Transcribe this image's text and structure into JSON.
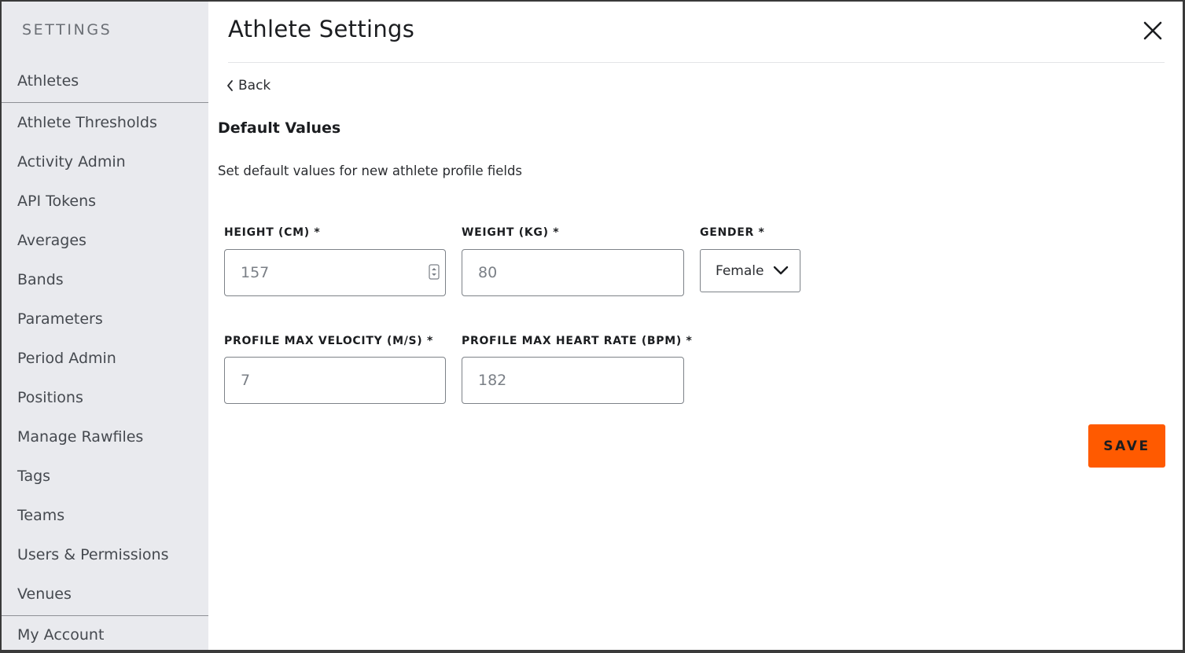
{
  "sidebar": {
    "heading": "SETTINGS",
    "items": [
      {
        "label": "Athletes"
      },
      {
        "label": "Athlete Thresholds"
      },
      {
        "label": "Activity Admin"
      },
      {
        "label": "API Tokens"
      },
      {
        "label": "Averages"
      },
      {
        "label": "Bands"
      },
      {
        "label": "Parameters"
      },
      {
        "label": "Period Admin"
      },
      {
        "label": "Positions"
      },
      {
        "label": "Manage Rawfiles"
      },
      {
        "label": "Tags"
      },
      {
        "label": "Teams"
      },
      {
        "label": "Users & Permissions"
      },
      {
        "label": "Venues"
      },
      {
        "label": "My Account"
      }
    ]
  },
  "header": {
    "title": "Athlete Settings"
  },
  "nav": {
    "back_label": "Back"
  },
  "section": {
    "title": "Default Values",
    "description": "Set default values for new athlete profile fields"
  },
  "fields": {
    "height": {
      "label": "HEIGHT (CM) *",
      "value": "157"
    },
    "weight": {
      "label": "WEIGHT (KG) *",
      "value": "80"
    },
    "gender": {
      "label": "GENDER *",
      "value": "Female"
    },
    "max_velocity": {
      "label": "PROFILE MAX VELOCITY (M/S) *",
      "value": "7"
    },
    "max_heart_rate": {
      "label": "PROFILE MAX HEART RATE (BPM) *",
      "value": "182"
    }
  },
  "actions": {
    "save_label": "SAVE"
  },
  "colors": {
    "accent": "#ff5a00",
    "sidebar_bg": "#e9eaee"
  }
}
